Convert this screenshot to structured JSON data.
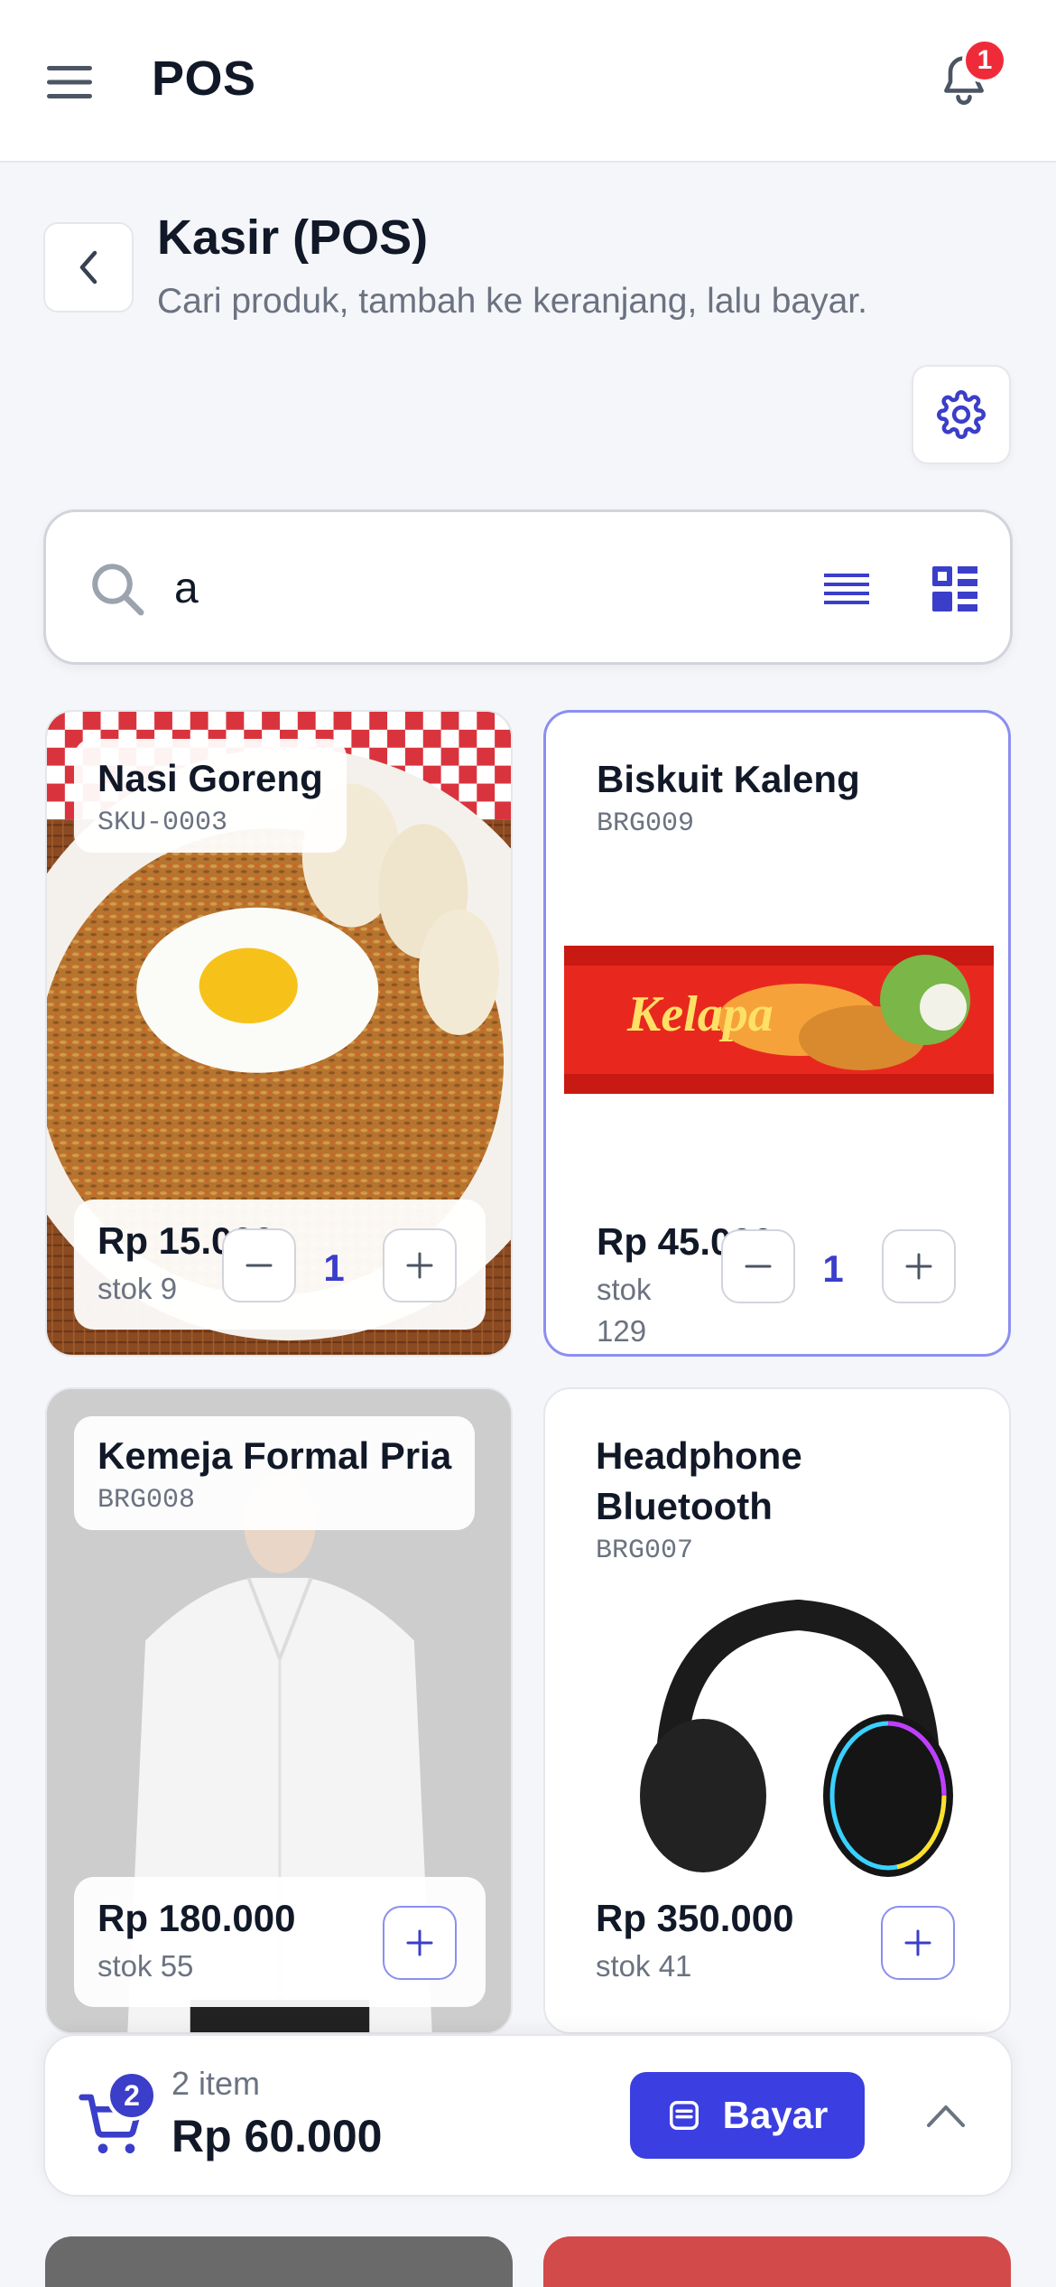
{
  "appbar": {
    "title": "POS",
    "notification_count": "1"
  },
  "header": {
    "title": "Kasir (POS)",
    "subtitle": "Cari produk, tambah ke keranjang, lalu bayar."
  },
  "search": {
    "value": "a"
  },
  "products": [
    {
      "name": "Nasi Goreng",
      "sku": "SKU-0003",
      "price": "Rp 15.000",
      "stock": "stok 9",
      "qty": "1"
    },
    {
      "name": "Biskuit Kaleng",
      "sku": "BRG009",
      "price": "Rp 45.000",
      "stock_line1": "stok",
      "stock_line2": "129",
      "qty": "1"
    },
    {
      "name": "Kemeja Formal Pria",
      "sku": "BRG008",
      "price": "Rp 180.000",
      "stock": "stok 55"
    },
    {
      "name_line1": "Headphone",
      "name_line2": "Bluetooth",
      "sku": "BRG007",
      "price": "Rp 350.000",
      "stock": "stok 41"
    }
  ],
  "cart": {
    "badge": "2",
    "count_label": "2 item",
    "total": "Rp 60.000",
    "pay_label": "Bayar"
  },
  "colors": {
    "accent": "#3b3ee0",
    "badge_red": "#ef2b3a"
  }
}
